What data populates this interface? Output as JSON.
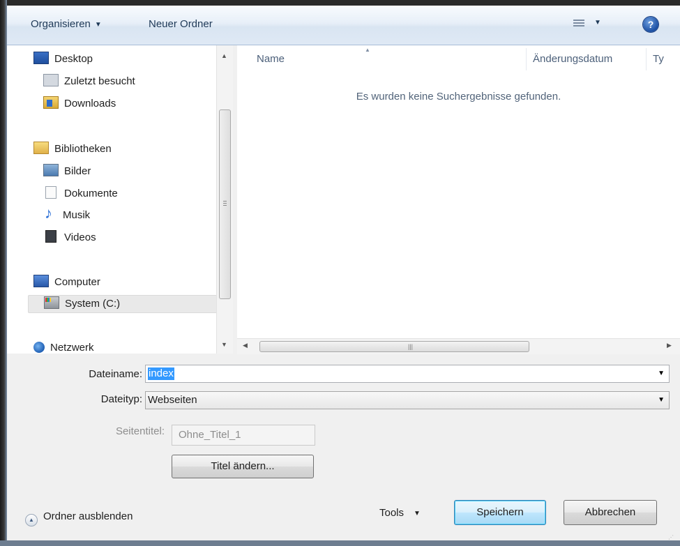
{
  "toolbar": {
    "organize_label": "Organisieren",
    "new_folder_label": "Neuer Ordner",
    "help_label": "?"
  },
  "nav": {
    "items": [
      {
        "label": "Desktop",
        "icon": "desktop-icon"
      },
      {
        "label": "Zuletzt besucht",
        "icon": "recent-places-icon"
      },
      {
        "label": "Downloads",
        "icon": "downloads-folder-icon"
      },
      {
        "label": "Bibliotheken",
        "icon": "libraries-icon"
      },
      {
        "label": "Bilder",
        "icon": "pictures-icon"
      },
      {
        "label": "Dokumente",
        "icon": "documents-icon"
      },
      {
        "label": "Musik",
        "icon": "music-icon"
      },
      {
        "label": "Videos",
        "icon": "videos-icon"
      },
      {
        "label": "Computer",
        "icon": "computer-icon"
      },
      {
        "label": "System (C:)",
        "icon": "system-drive-icon",
        "selected": true
      },
      {
        "label": "Netzwerk",
        "icon": "network-icon"
      }
    ]
  },
  "content": {
    "columns": [
      "Name",
      "Änderungsdatum",
      "Ty"
    ],
    "empty_message": "Es wurden keine Suchergebnisse gefunden."
  },
  "form": {
    "filename_label": "Dateiname:",
    "filename_value": "index",
    "filetype_label": "Dateityp:",
    "filetype_value": "Webseiten",
    "pagetitle_label": "Seitentitel:",
    "pagetitle_value": "Ohne_Titel_1",
    "change_title_label": "Titel ändern..."
  },
  "footer": {
    "hide_folders_label": "Ordner ausblenden",
    "tools_label": "Tools",
    "save_label": "Speichern",
    "cancel_label": "Abbrechen"
  },
  "colors": {
    "selection": "#3399ff",
    "toolbar_text": "#1e3957",
    "primary_button_border": "#3c7fb1"
  }
}
